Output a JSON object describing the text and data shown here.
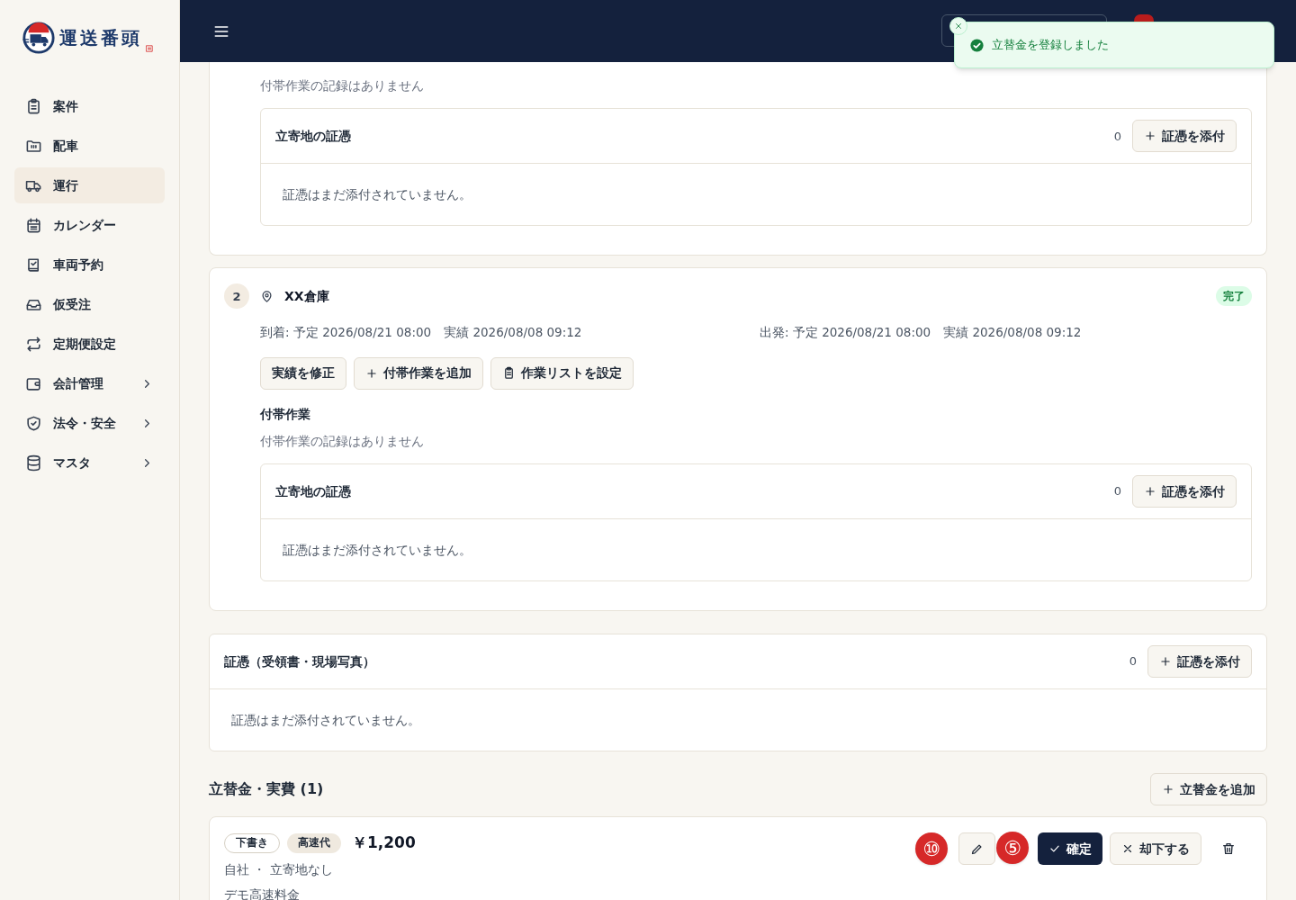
{
  "brand": {
    "name": "運送番頭"
  },
  "sidebar": {
    "items": [
      {
        "label": "案件",
        "selected": false,
        "expandable": false
      },
      {
        "label": "配車",
        "selected": false,
        "expandable": false
      },
      {
        "label": "運行",
        "selected": true,
        "expandable": false
      },
      {
        "label": "カレンダー",
        "selected": false,
        "expandable": false
      },
      {
        "label": "車両予約",
        "selected": false,
        "expandable": false
      },
      {
        "label": "仮受注",
        "selected": false,
        "expandable": false
      },
      {
        "label": "定期便設定",
        "selected": false,
        "expandable": false
      },
      {
        "label": "会計管理",
        "selected": false,
        "expandable": true
      },
      {
        "label": "法令・安全",
        "selected": false,
        "expandable": true
      },
      {
        "label": "マスタ",
        "selected": false,
        "expandable": true
      }
    ]
  },
  "toast": {
    "kind": "success",
    "message": "立替金を登録しました"
  },
  "stops": [
    {
      "partial": true,
      "tasks_empty": "付帯作業の記録はありません",
      "evidence": {
        "title": "立寄地の証憑",
        "count": "0",
        "button": "証憑を添付",
        "empty": "証憑はまだ添付されていません。"
      }
    },
    {
      "partial": false,
      "number": "2",
      "name": "XX倉庫",
      "status": "完了",
      "arrival": "到着: 予定 2026/08/21 08:00　実績 2026/08/08 09:12",
      "departure": "出発: 予定 2026/08/21 08:00　実績 2026/08/08 09:12",
      "buttons": [
        {
          "kind": "plain",
          "label": "実績を修正"
        },
        {
          "kind": "add",
          "label": "付帯作業を追加"
        },
        {
          "kind": "list",
          "label": "作業リストを設定"
        }
      ],
      "tasks_heading": "付帯作業",
      "tasks_empty": "付帯作業の記録はありません",
      "evidence": {
        "title": "立寄地の証憑",
        "count": "0",
        "button": "証憑を添付",
        "empty": "証憑はまだ添付されていません。"
      }
    }
  ],
  "evidence": {
    "title": "証憑（受領書・現場写真）",
    "count": "0",
    "button": "証憑を添付",
    "empty": "証憑はまだ添付されていません。"
  },
  "expenses": {
    "title": "立替金・実費 (1)",
    "add_button": "立替金を追加",
    "items": [
      {
        "status": "下書き",
        "category": "高速代",
        "amount": "￥1,200",
        "meta": "自社 ・ 立寄地なし",
        "description": "デモ高速料金",
        "confirm_label": "確定",
        "reject_label": "却下する"
      }
    ]
  },
  "markers": [
    {
      "label": "⑩"
    },
    {
      "label": "⑤"
    }
  ]
}
